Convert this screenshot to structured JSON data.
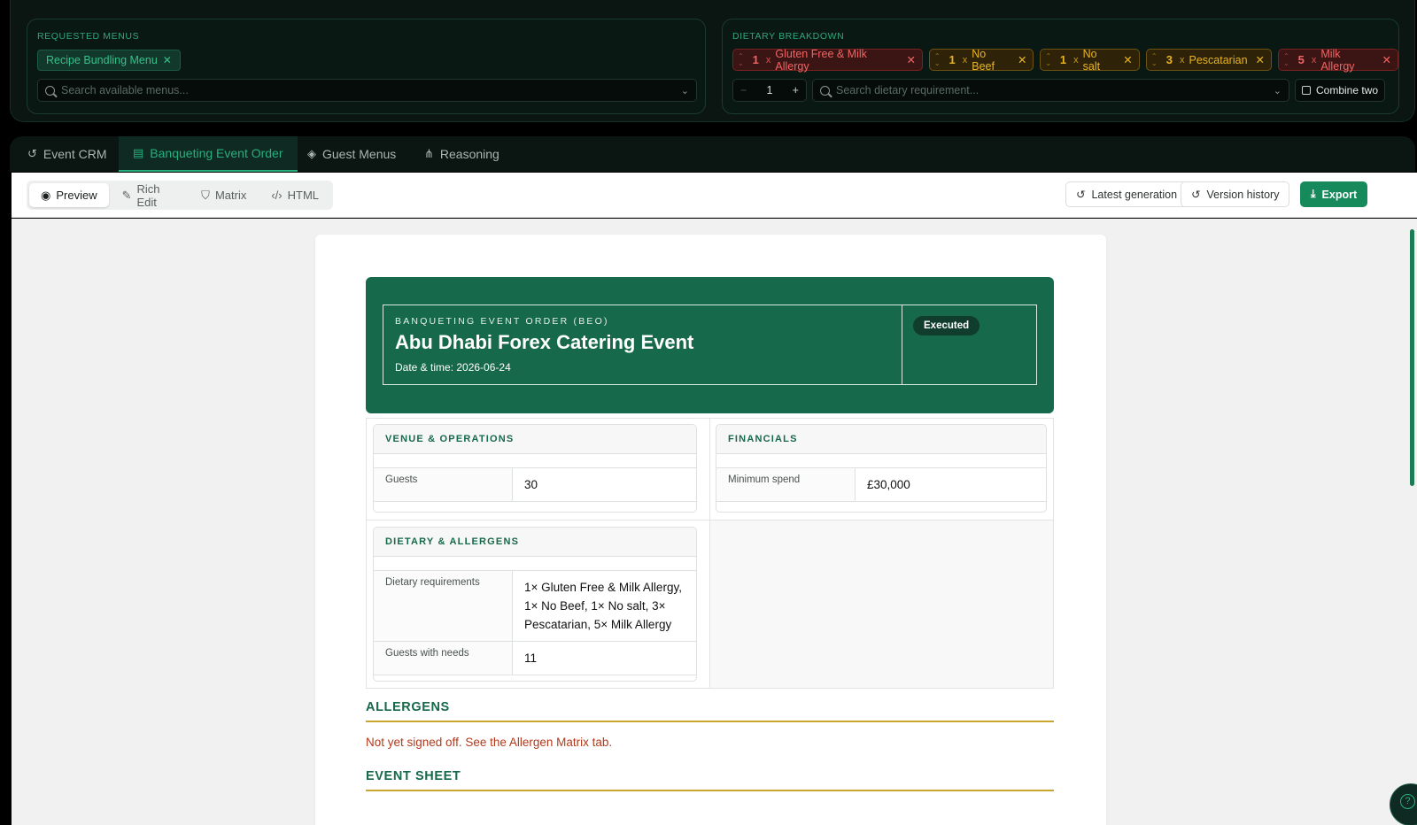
{
  "requested_menus": {
    "label": "REQUESTED MENUS",
    "chips": [
      {
        "label": "Recipe Bundling Menu"
      }
    ],
    "search_placeholder": "Search available menus..."
  },
  "dietary_breakdown": {
    "label": "DIETARY BREAKDOWN",
    "chips": [
      {
        "count": "1",
        "times": "x",
        "label": "Gluten Free & Milk Allergy",
        "tone": "red"
      },
      {
        "count": "1",
        "times": "x",
        "label": "No Beef",
        "tone": "amber"
      },
      {
        "count": "1",
        "times": "x",
        "label": "No salt",
        "tone": "amber"
      },
      {
        "count": "3",
        "times": "x",
        "label": "Pescatarian",
        "tone": "amber"
      },
      {
        "count": "5",
        "times": "x",
        "label": "Milk Allergy",
        "tone": "red"
      }
    ],
    "stepper": {
      "minus": "−",
      "value": "1",
      "plus": "+"
    },
    "search_placeholder": "Search dietary requirement...",
    "combine_label": "Combine two"
  },
  "tabs": [
    {
      "label": "Event CRM",
      "icon": "history-icon"
    },
    {
      "label": "Banqueting Event Order",
      "icon": "document-icon",
      "active": true
    },
    {
      "label": "Guest Menus",
      "icon": "layers-icon"
    },
    {
      "label": "Reasoning",
      "icon": "network-icon"
    }
  ],
  "view_modes": [
    {
      "label": "Preview",
      "icon": "eye-icon",
      "active": true
    },
    {
      "label": "Rich Edit",
      "icon": "pen-icon"
    },
    {
      "label": "Matrix",
      "icon": "shield-icon"
    },
    {
      "label": "HTML",
      "icon": "code-icon"
    }
  ],
  "toolbar": {
    "latest_generation": "Latest generation",
    "version_history": "Version history",
    "export": "Export"
  },
  "beo": {
    "kicker": "BANQUETING EVENT ORDER (BEO)",
    "title": "Abu Dhabi Forex Catering Event",
    "date": "Date & time: 2026-06-24",
    "status": "Executed",
    "venue": {
      "heading": "VENUE & OPERATIONS",
      "rows": [
        {
          "key": "Guests",
          "value": "30"
        }
      ]
    },
    "financials": {
      "heading": "FINANCIALS",
      "rows": [
        {
          "key": "Minimum spend",
          "value": "£30,000"
        }
      ]
    },
    "dietary": {
      "heading": "DIETARY & ALLERGENS",
      "rows": [
        {
          "key": "Dietary requirements",
          "value": "1× Gluten Free & Milk Allergy, 1× No Beef, 1× No salt, 3× Pescatarian, 5× Milk Allergy"
        },
        {
          "key": "Guests with needs",
          "value": "11"
        }
      ]
    },
    "allergens_title": "ALLERGENS",
    "allergens_note": "Not yet signed off. See the Allergen Matrix tab.",
    "event_sheet_title": "EVENT SHEET"
  },
  "colors": {
    "brand_green": "#16694a",
    "accent_green": "#27b07e",
    "allergen_red": "#f26464",
    "diet_amber": "#e9b423",
    "rule_gold": "#c9a72c"
  }
}
